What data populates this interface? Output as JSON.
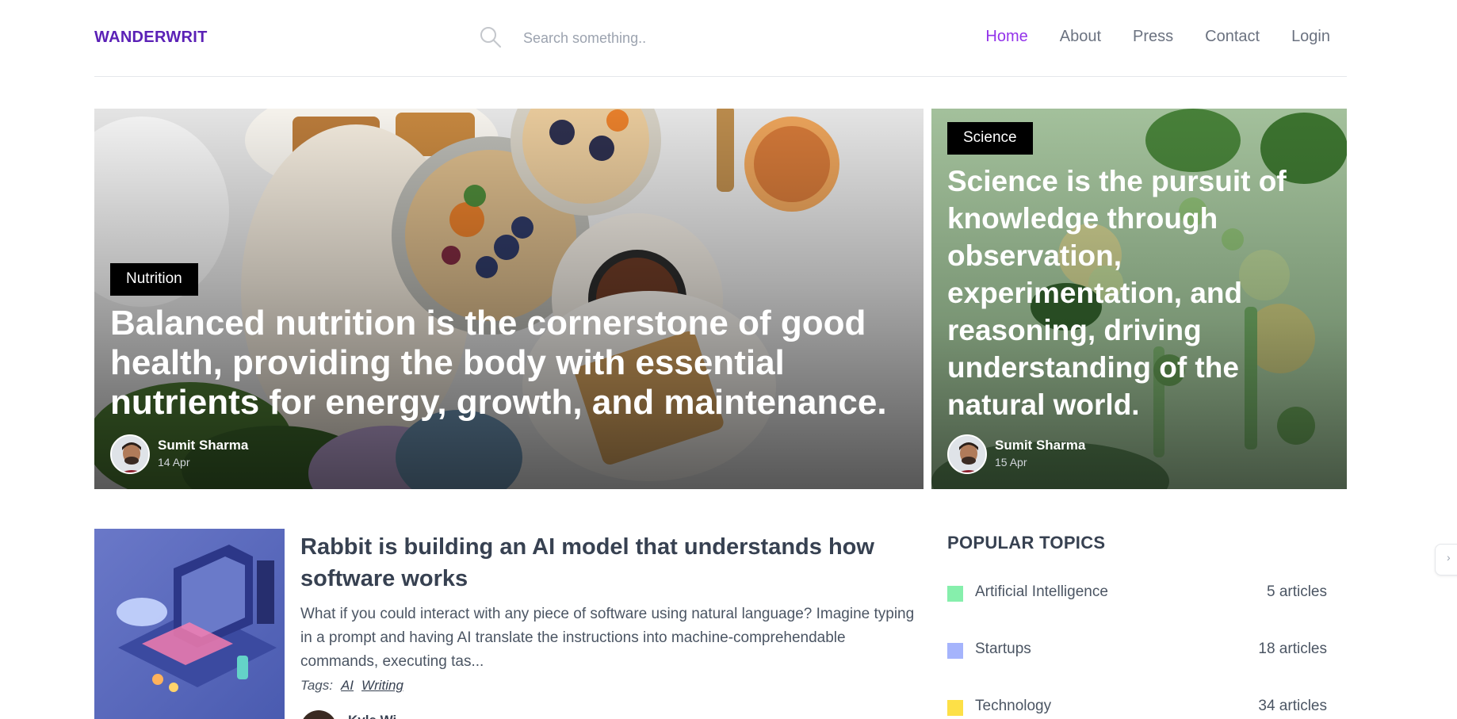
{
  "header": {
    "logo": "WANDERWRIT",
    "search_placeholder": "Search something..",
    "search_icon": "search-icon",
    "nav": [
      {
        "label": "Home",
        "active": true
      },
      {
        "label": "About",
        "active": false
      },
      {
        "label": "Press",
        "active": false
      },
      {
        "label": "Contact",
        "active": false
      },
      {
        "label": "Login",
        "active": false
      }
    ]
  },
  "featured": [
    {
      "category": "Nutrition",
      "title": "Balanced nutrition is the cornerstone of good health, providing the body with essential nutrients for energy, growth, and maintenance.",
      "author": "Sumit Sharma",
      "date": "14 Apr"
    },
    {
      "category": "Science",
      "title": "Science is the pursuit of knowledge through observation, experimentation, and reasoning, driving understanding of the natural world.",
      "author": "Sumit Sharma",
      "date": "15 Apr"
    }
  ],
  "post": {
    "title": "Rabbit is building an AI model that understands how software works",
    "excerpt": "What if you could interact with any piece of software using natural language? Imagine typing in a prompt and having AI translate the instructions into machine-comprehendable commands, executing tas...",
    "tags_label": "Tags:",
    "tags": [
      "AI",
      "Writing"
    ],
    "author": "Kyle Wi..."
  },
  "sidebar": {
    "heading": "POPULAR TOPICS",
    "topics": [
      {
        "label": "Artificial Intelligence",
        "count": "5 articles",
        "color": "#86efac"
      },
      {
        "label": "Startups",
        "count": "18 articles",
        "color": "#a5b4fc"
      },
      {
        "label": "Technology",
        "count": "34 articles",
        "color": "#fde047"
      }
    ]
  },
  "colors": {
    "brand": "#5b21b6",
    "nav_active": "#9333ea",
    "text": "#374151"
  }
}
